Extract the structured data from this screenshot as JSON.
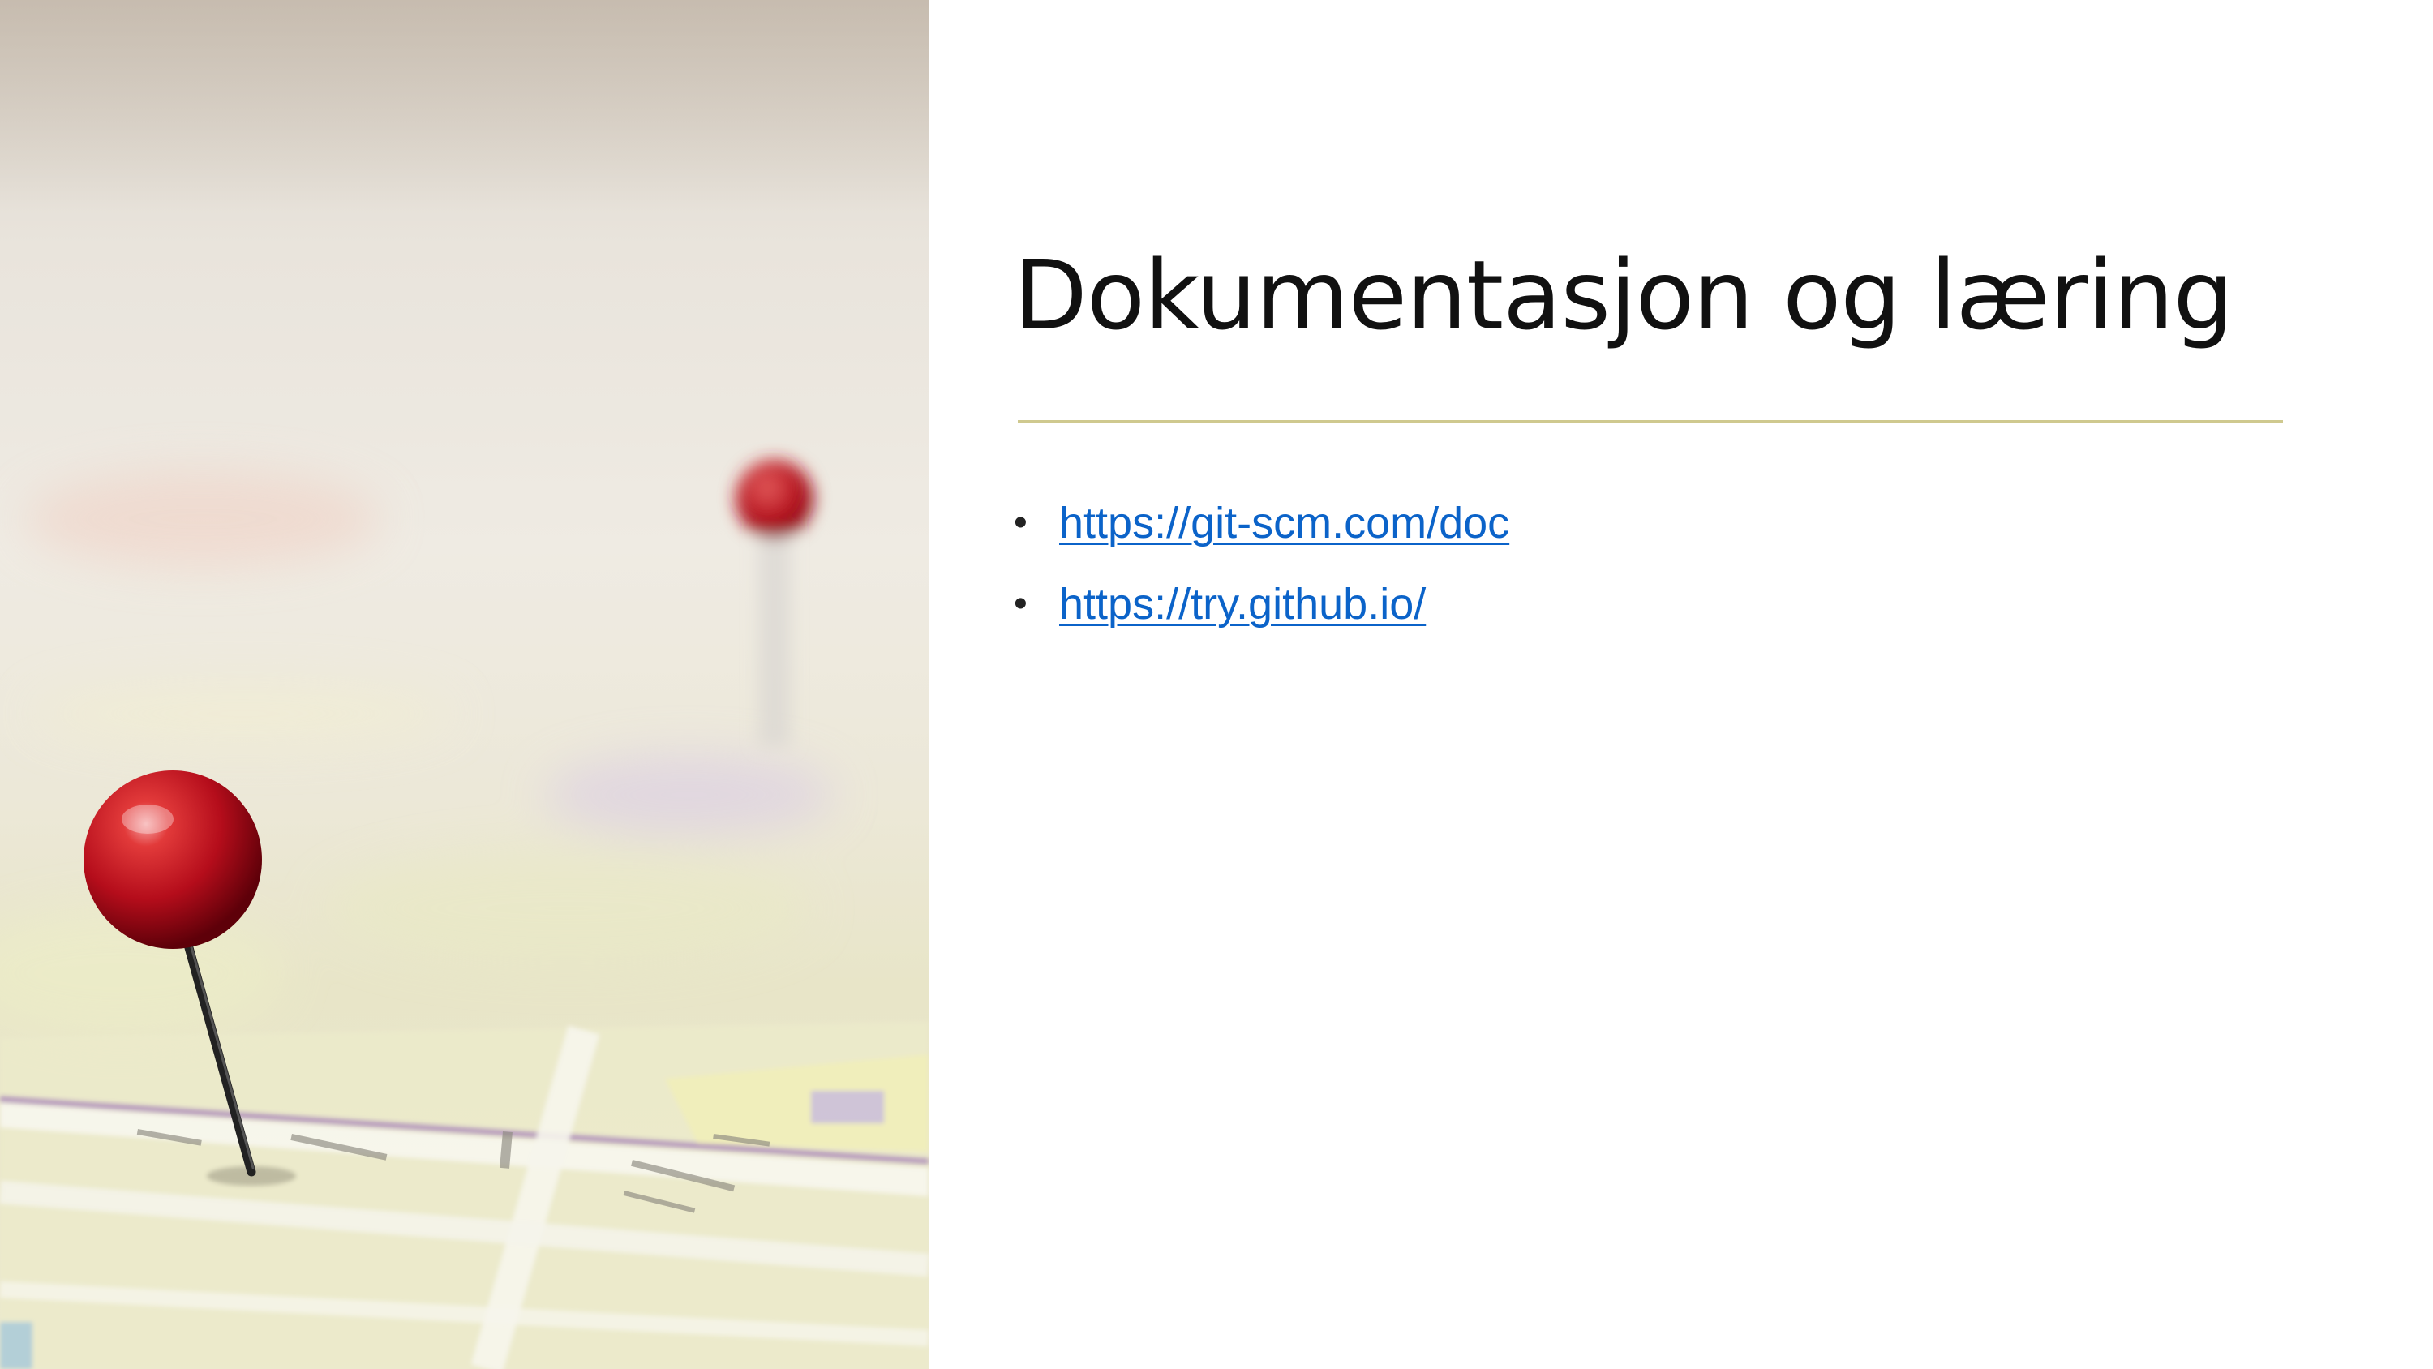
{
  "slide": {
    "title": "Dokumentasjon og læring",
    "links": [
      {
        "text": "https://git-scm.com/doc",
        "href": "https://git-scm.com/doc"
      },
      {
        "text": "https://try.github.io/",
        "href": "https://try.github.io/"
      }
    ],
    "bullet_glyph": "•",
    "colors": {
      "title": "#111111",
      "link": "#0b63c9",
      "rule": "#cfc98f",
      "pin": "#c8101e"
    }
  }
}
